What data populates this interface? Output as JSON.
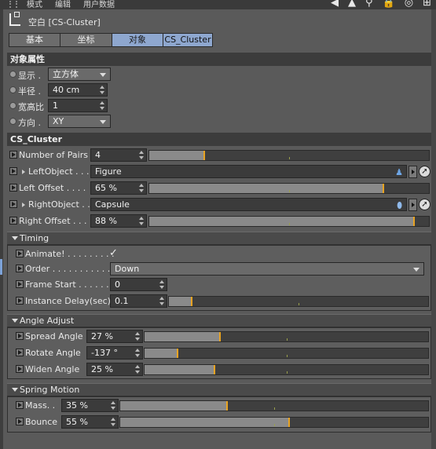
{
  "menubar": {
    "items": [
      "模式",
      "编辑",
      "用户数据"
    ],
    "tools": [
      "◀",
      "▲",
      "⚲",
      "🔒",
      "◎",
      "⊞"
    ]
  },
  "title": "空白 [CS-Cluster]",
  "tabs": [
    "基本",
    "坐标",
    "对象",
    "CS_Cluster"
  ],
  "object_props": {
    "heading": "对象属性",
    "display": {
      "label": "显示 .",
      "value": "立方体"
    },
    "radius": {
      "label": "半径 .",
      "value": "40 cm"
    },
    "aspect": {
      "label": "宽高比",
      "value": "1"
    },
    "direction": {
      "label": "方向 .",
      "value": "XY"
    }
  },
  "cluster": {
    "heading": "CS_Cluster",
    "pairs": {
      "label": "Number of Pairs",
      "value": "4",
      "fraction": 0.2
    },
    "left_object": {
      "label": "LeftObject . . .",
      "value": "Figure"
    },
    "left_offset": {
      "label": "Left Offset . . . .",
      "value": "65 %",
      "fraction": 0.84
    },
    "right_object": {
      "label": "RightObject . .",
      "value": "Capsule"
    },
    "right_offset": {
      "label": "Right Offset . . .",
      "value": "88 %",
      "fraction": 0.95
    }
  },
  "timing": {
    "heading": "Timing",
    "animate": {
      "label": "Animate! . . . . . . . . .",
      "value": "✓"
    },
    "order": {
      "label": "Order . . . . . . . . . . . .",
      "value": "Down"
    },
    "frame_start": {
      "label": "Frame Start . . . . . . .",
      "value": "0"
    },
    "instance_delay": {
      "label": "Instance Delay(sec)",
      "value": "0.1",
      "fraction": 0.09
    }
  },
  "angle": {
    "heading": "Angle Adjust",
    "spread": {
      "label": "Spread Angle",
      "value": "27 %",
      "fraction": 0.27
    },
    "rotate": {
      "label": "Rotate Angle",
      "value": "-137 °",
      "fraction": 0.12
    },
    "widen": {
      "label": "Widen Angle",
      "value": "25 %",
      "fraction": 0.25
    }
  },
  "spring": {
    "heading": "Spring Motion",
    "mass": {
      "label": "Mass. .",
      "value": "35 %",
      "fraction": 0.35
    },
    "bounce": {
      "label": "Bounce",
      "value": "55 %",
      "fraction": 0.55
    }
  }
}
